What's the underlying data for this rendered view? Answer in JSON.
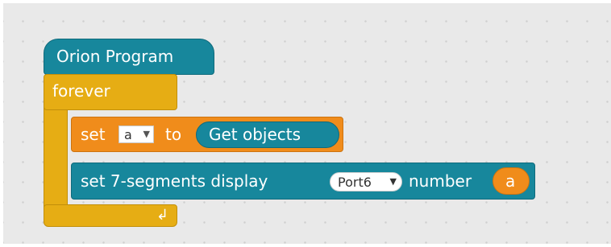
{
  "workspace": {
    "program_block": "Orion Program",
    "forever_block": "forever",
    "set_block": {
      "set_label": "set",
      "variable": "a",
      "to_label": "to",
      "reporter": "Get objects"
    },
    "display_block": {
      "label": "set 7-segments display",
      "port": "Port6",
      "number_label": "number",
      "variable": "a"
    }
  },
  "colors": {
    "control_yellow": "#e6ad14",
    "data_orange": "#f08c1b",
    "device_teal": "#17879c",
    "workspace_bg": "#e9e9e9"
  }
}
